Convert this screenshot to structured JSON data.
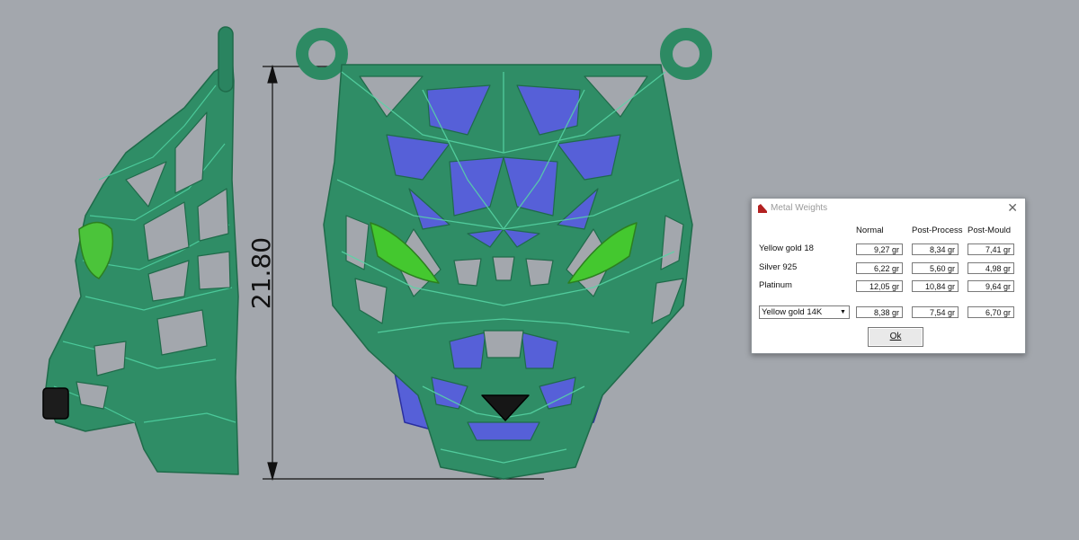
{
  "viewport": {
    "background": "#a3a7ad",
    "model_color": "#2d8a63",
    "dimension_label": "21.80"
  },
  "dialog": {
    "title": "Metal Weights",
    "close_glyph": "✕",
    "headers": [
      "Normal",
      "Post-Process",
      "Post-Mould"
    ],
    "rows": [
      {
        "label": "Yellow gold 18",
        "values": [
          "9,27 gr",
          "8,34 gr",
          "7,41 gr"
        ]
      },
      {
        "label": "Silver 925",
        "values": [
          "6,22 gr",
          "5,60 gr",
          "4,98 gr"
        ]
      },
      {
        "label": "Platinum",
        "values": [
          "12,05 gr",
          "10,84 gr",
          "9,64 gr"
        ]
      }
    ],
    "select": {
      "value": "Yellow gold 14K",
      "values": [
        "8,38 gr",
        "7,54 gr",
        "6,70 gr"
      ]
    },
    "ok_label": "Ok"
  }
}
